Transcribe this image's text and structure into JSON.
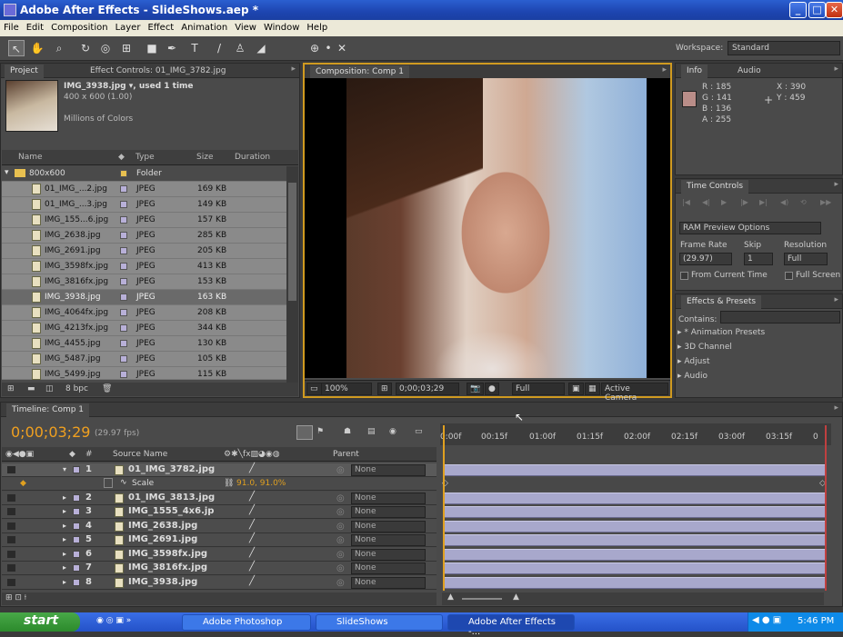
{
  "window": {
    "title": "Adobe After Effects - SlideShows.aep *",
    "min": "_",
    "max": "□",
    "close": "✕"
  },
  "menu": [
    "File",
    "Edit",
    "Composition",
    "Layer",
    "Effect",
    "Animation",
    "View",
    "Window",
    "Help"
  ],
  "toolbar": {
    "workspace_label": "Workspace:",
    "workspace_value": "Standard"
  },
  "project": {
    "tab": "Project",
    "tab2": "Effect Controls: 01_IMG_3782.jpg",
    "selected_name": "IMG_3938.jpg ▾, used 1 time",
    "selected_dims": "400 x 600 (1.00)",
    "selected_colors": "Millions of Colors",
    "columns": {
      "name": "Name",
      "type": "Type",
      "size": "Size",
      "duration": "Duration"
    },
    "folder": {
      "name": "800x600",
      "type": "Folder"
    },
    "files": [
      {
        "name": "01_IMG_...2.jpg",
        "type": "JPEG",
        "size": "169 KB"
      },
      {
        "name": "01_IMG_...3.jpg",
        "type": "JPEG",
        "size": "149 KB"
      },
      {
        "name": "IMG_155...6.jpg",
        "type": "JPEG",
        "size": "157 KB"
      },
      {
        "name": "IMG_2638.jpg",
        "type": "JPEG",
        "size": "285 KB"
      },
      {
        "name": "IMG_2691.jpg",
        "type": "JPEG",
        "size": "205 KB"
      },
      {
        "name": "IMG_3598fx.jpg",
        "type": "JPEG",
        "size": "413 KB"
      },
      {
        "name": "IMG_3816fx.jpg",
        "type": "JPEG",
        "size": "153 KB"
      },
      {
        "name": "IMG_3938.jpg",
        "type": "JPEG",
        "size": "163 KB"
      },
      {
        "name": "IMG_4064fx.jpg",
        "type": "JPEG",
        "size": "208 KB"
      },
      {
        "name": "IMG_4213fx.jpg",
        "type": "JPEG",
        "size": "344 KB"
      },
      {
        "name": "IMG_4455.jpg",
        "type": "JPEG",
        "size": "130 KB"
      },
      {
        "name": "IMG_5487.jpg",
        "type": "JPEG",
        "size": "105 KB"
      },
      {
        "name": "IMG_5499.jpg",
        "type": "JPEG",
        "size": "115 KB"
      }
    ],
    "bpc": "8 bpc"
  },
  "composition": {
    "tab": "Composition: Comp 1",
    "zoom": "100%",
    "timecode": "0;00;03;29",
    "resolution": "Full",
    "camera": "Active Camera"
  },
  "info": {
    "tab": "Info",
    "tab2": "Audio",
    "r": "R : 185",
    "g": "G : 141",
    "b": "B : 136",
    "a": "A : 255",
    "x": "X : 390",
    "y": "Y : 459",
    "swatch_color": "#b98d88"
  },
  "time_controls": {
    "tab": "Time Controls",
    "ram": "RAM Preview Options",
    "frame_rate_label": "Frame Rate",
    "skip_label": "Skip",
    "resolution_label": "Resolution",
    "frame_rate": "(29.97)",
    "skip": "1",
    "resolution": "Full",
    "from_current": "From Current Time",
    "full_screen": "Full Screen"
  },
  "effects": {
    "tab": "Effects & Presets",
    "contains_label": "Contains:",
    "items": [
      "* Animation Presets",
      "3D Channel",
      "Adjust",
      "Audio"
    ]
  },
  "timeline": {
    "tab": "Timeline: Comp 1",
    "timecode": "0;00;03;29",
    "fps": "(29.97 fps)",
    "headers": {
      "num": "#",
      "source": "Source Name",
      "parent": "Parent"
    },
    "scale_label": "Scale",
    "scale_value": "91.0, 91.0%",
    "ticks": [
      "0:00f",
      "00:15f",
      "01:00f",
      "01:15f",
      "02:00f",
      "02:15f",
      "03:00f",
      "03:15f",
      "0"
    ],
    "layers": [
      {
        "num": "1",
        "name": "01_IMG_3782.jpg",
        "parent": "None"
      },
      {
        "num": "2",
        "name": "01_IMG_3813.jpg",
        "parent": "None"
      },
      {
        "num": "3",
        "name": "IMG_1555_4x6.jp",
        "parent": "None"
      },
      {
        "num": "4",
        "name": "IMG_2638.jpg",
        "parent": "None"
      },
      {
        "num": "5",
        "name": "IMG_2691.jpg",
        "parent": "None"
      },
      {
        "num": "6",
        "name": "IMG_3598fx.jpg",
        "parent": "None"
      },
      {
        "num": "7",
        "name": "IMG_3816fx.jpg",
        "parent": "None"
      },
      {
        "num": "8",
        "name": "IMG_3938.jpg",
        "parent": "None"
      }
    ]
  },
  "taskbar": {
    "start": "start",
    "tasks": [
      "Adobe Photoshop",
      "SlideShows",
      "Adobe After Effects -..."
    ],
    "clock": "5:46 PM"
  }
}
